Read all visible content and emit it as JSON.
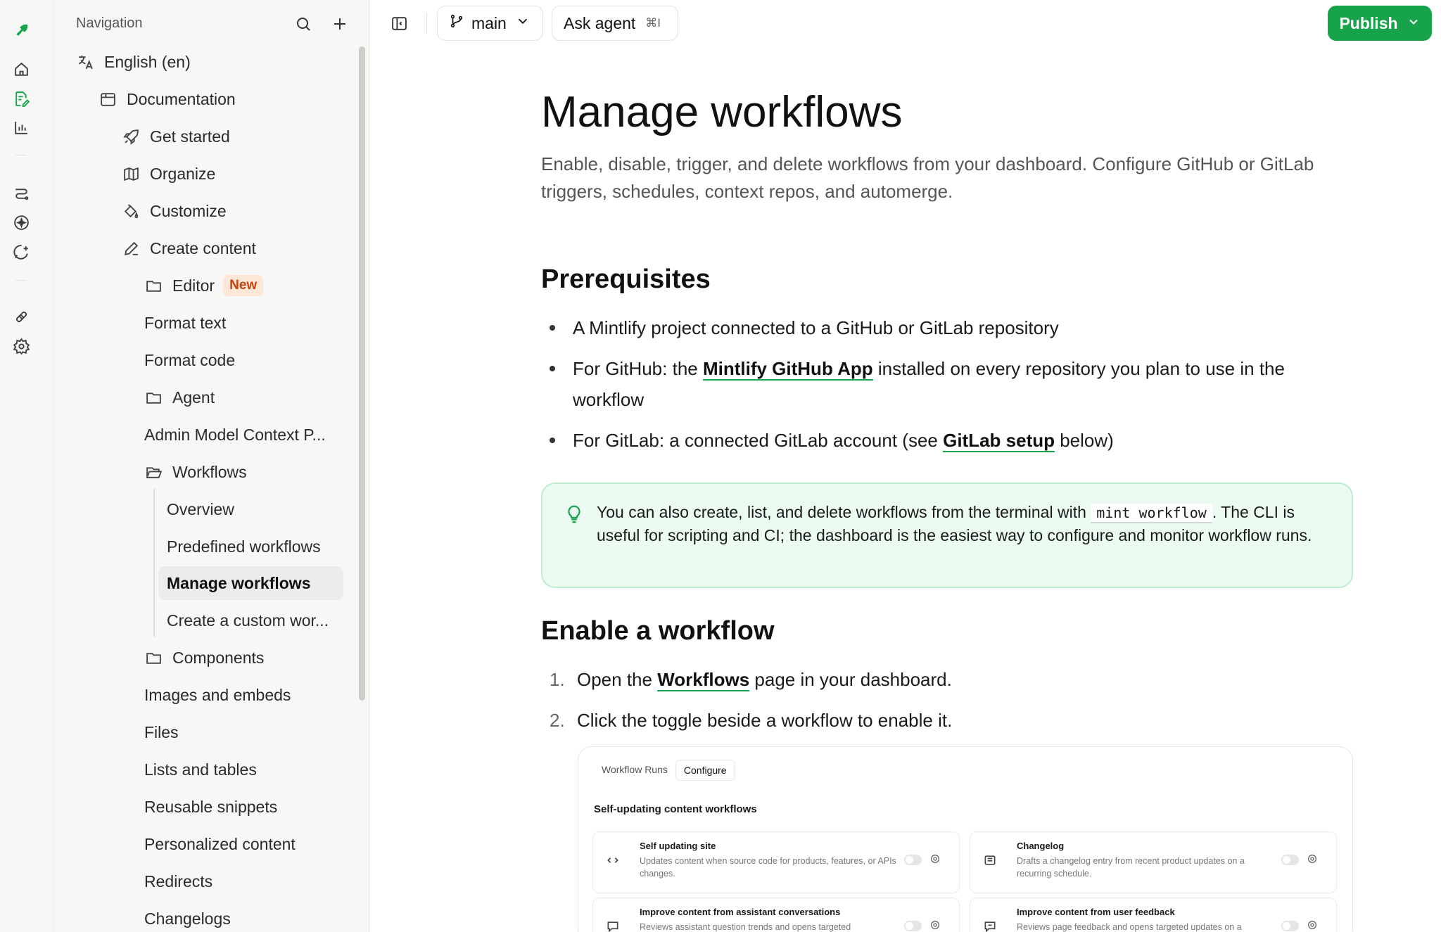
{
  "sidebar": {
    "heading": "Navigation",
    "items": [
      {
        "label": "English (en)"
      },
      {
        "label": "Documentation"
      },
      {
        "label": "Get started"
      },
      {
        "label": "Organize"
      },
      {
        "label": "Customize"
      },
      {
        "label": "Create content"
      },
      {
        "label": "Editor",
        "badge": "New"
      },
      {
        "label": "Format text"
      },
      {
        "label": "Format code"
      },
      {
        "label": "Agent"
      },
      {
        "label": "Admin Model Context P..."
      },
      {
        "label": "Workflows"
      },
      {
        "label": "Overview"
      },
      {
        "label": "Predefined workflows"
      },
      {
        "label": "Manage workflows"
      },
      {
        "label": "Create a custom wor..."
      },
      {
        "label": "Components"
      },
      {
        "label": "Images and embeds"
      },
      {
        "label": "Files"
      },
      {
        "label": "Lists and tables"
      },
      {
        "label": "Reusable snippets"
      },
      {
        "label": "Personalized content"
      },
      {
        "label": "Redirects"
      },
      {
        "label": "Changelogs"
      }
    ]
  },
  "topbar": {
    "branch": "main",
    "ask_agent": "Ask agent",
    "ask_shortcut": "⌘I",
    "publish": "Publish"
  },
  "page": {
    "title": "Manage workflows",
    "lead": "Enable, disable, trigger, and delete workflows from your dashboard. Configure GitHub or GitLab triggers, schedules, context repos, and automerge.",
    "prereq_heading": "Prerequisites",
    "prereq": {
      "item1": "A Mintlify project connected to a GitHub or GitLab repository",
      "item2_pre": "For GitHub: the ",
      "item2_link": "Mintlify GitHub App",
      "item2_post": " installed on every repository you plan to use in the workflow",
      "item3_pre": "For GitLab: a connected GitLab account (see ",
      "item3_link": "GitLab setup",
      "item3_post": " below)"
    },
    "callout": {
      "pre": "You can also create, list, and delete workflows from the terminal with ",
      "code": "mint workflow",
      "post": ". The CLI is useful for scripting and CI; the dashboard is the easiest way to configure and monitor workflow runs."
    },
    "enable_heading": "Enable a workflow",
    "steps": {
      "n1": "1.",
      "s1_pre": "Open the ",
      "s1_link": "Workflows",
      "s1_post": " page in your dashboard.",
      "n2": "2.",
      "s2": "Click the toggle beside a workflow to enable it."
    },
    "screenshot": {
      "tab_runs": "Workflow Runs",
      "tab_configure": "Configure",
      "section_title": "Self-updating content workflows",
      "cards": [
        {
          "name": "Self updating site",
          "desc": "Updates content when source code for products, features, or APIs changes."
        },
        {
          "name": "Changelog",
          "desc": "Drafts a changelog entry from recent product updates on a recurring schedule."
        },
        {
          "name": "Improve content from assistant conversations",
          "desc": "Reviews assistant question trends and opens targeted"
        },
        {
          "name": "Improve content from user feedback",
          "desc": "Reviews page feedback and opens targeted updates on a"
        }
      ]
    }
  }
}
